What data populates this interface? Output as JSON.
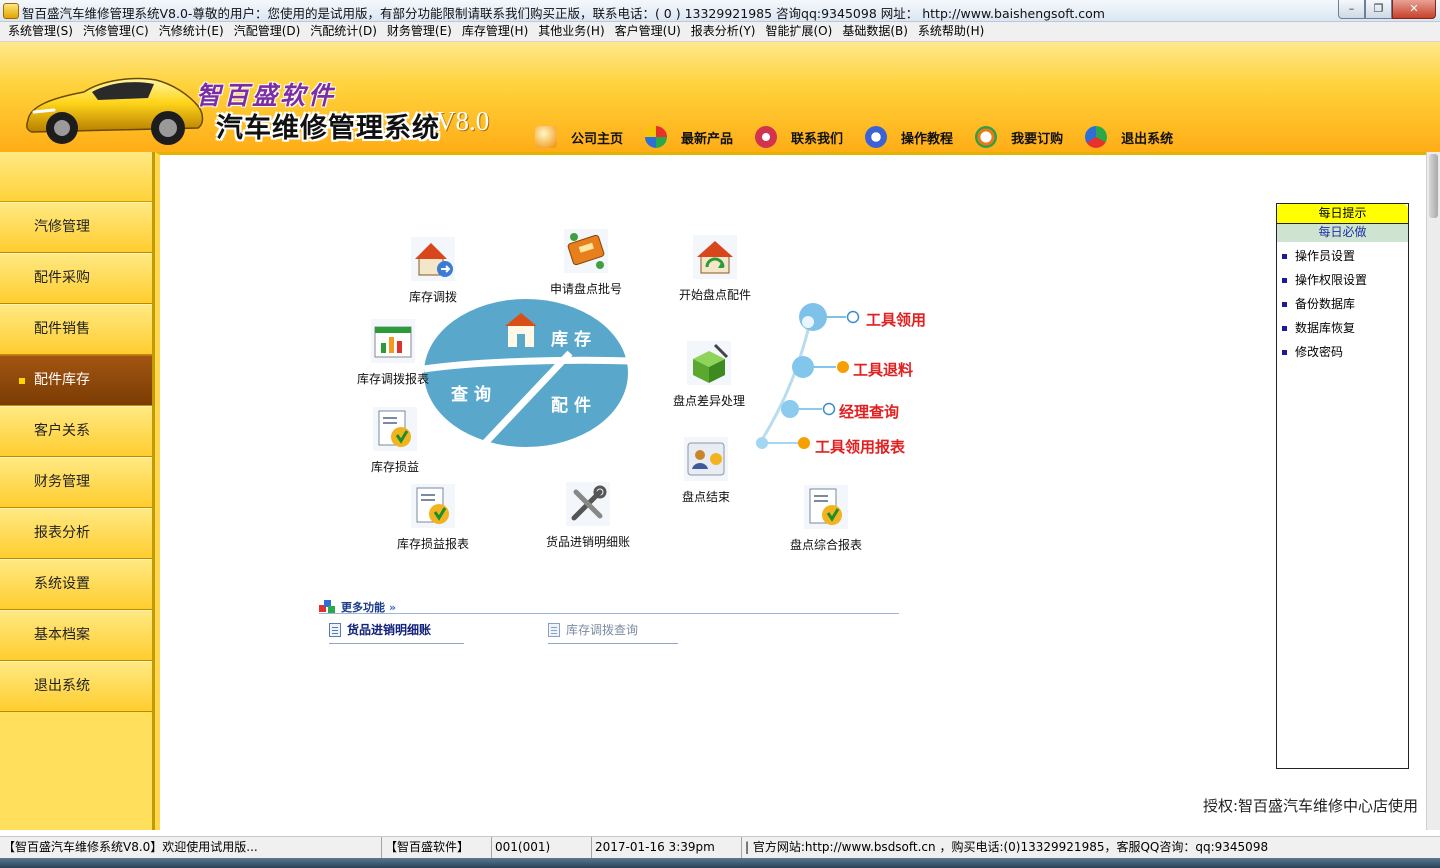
{
  "window": {
    "title": "智百盛汽车维修管理系统V8.0-尊敬的用户：您使用的是试用版，有部分功能限制请联系我们购买正版，联系电话：( 0 ) 13329921985  咨询qq:9345098   网址： http://www.baishengsoft.com",
    "controls": {
      "minimize": "–",
      "restore": "❐",
      "close": "✕"
    }
  },
  "menubar": [
    "系统管理(S)",
    "汽修管理(C)",
    "汽修统计(E)",
    "汽配管理(D)",
    "汽配统计(D)",
    "财务管理(E)",
    "库存管理(H)",
    "其他业务(H)",
    "客户管理(U)",
    "报表分析(Y)",
    "智能扩展(O)",
    "基础数据(B)",
    "系统帮助(H)"
  ],
  "brand": {
    "company": "智百盛软件",
    "product": "汽车维修管理系统",
    "version": "V8.0"
  },
  "topnav": [
    {
      "label": "公司主页",
      "icon": "home-star-icon"
    },
    {
      "label": "最新产品",
      "icon": "new-product-icon"
    },
    {
      "label": "联系我们",
      "icon": "contact-icon"
    },
    {
      "label": "操作教程",
      "icon": "tutorial-icon"
    },
    {
      "label": "我要订购",
      "icon": "order-icon"
    },
    {
      "label": "退出系统",
      "icon": "exit-icon"
    }
  ],
  "sidebar": {
    "items": [
      {
        "label": "汽修管理",
        "active": false
      },
      {
        "label": "配件采购",
        "active": false
      },
      {
        "label": "配件销售",
        "active": false
      },
      {
        "label": "配件库存",
        "active": true
      },
      {
        "label": "客户关系",
        "active": false
      },
      {
        "label": "财务管理",
        "active": false
      },
      {
        "label": "报表分析",
        "active": false
      },
      {
        "label": "系统设置",
        "active": false
      },
      {
        "label": "基本档案",
        "active": false
      },
      {
        "label": "退出系统",
        "active": false
      }
    ]
  },
  "hub": {
    "top": "库存",
    "left": "查询",
    "right": "配件"
  },
  "functions": [
    {
      "label": "库存调拨",
      "icon": "house-transfer-icon"
    },
    {
      "label": "申请盘点批号",
      "icon": "ticket-icon"
    },
    {
      "label": "开始盘点配件",
      "icon": "house-refresh-icon"
    },
    {
      "label": "库存调拨报表",
      "icon": "bar-report-icon"
    },
    {
      "label": "盘点差异处理",
      "icon": "box-edit-icon"
    },
    {
      "label": "库存损益",
      "icon": "document-money-icon"
    },
    {
      "label": "盘点结束",
      "icon": "person-money-icon"
    },
    {
      "label": "库存损益报表",
      "icon": "document-money-icon"
    },
    {
      "label": "货品进销明细账",
      "icon": "tools-icon"
    },
    {
      "label": "盘点综合报表",
      "icon": "document-money-icon"
    }
  ],
  "tools": [
    {
      "label": "工具领用",
      "marker": "hollow"
    },
    {
      "label": "工具退料",
      "marker": "filled"
    },
    {
      "label": "经理查询",
      "marker": "hollow"
    },
    {
      "label": "工具领用报表",
      "marker": "filled"
    }
  ],
  "more": {
    "title": "更多功能",
    "arrow": "»",
    "links": [
      {
        "label": "货品进销明细账",
        "bold": true
      },
      {
        "label": "库存调拨查询",
        "bold": false
      }
    ]
  },
  "tips": {
    "title": "每日提示",
    "subtitle": "每日必做",
    "items": [
      "操作员设置",
      "操作权限设置",
      "备份数据库",
      "数据库恢复",
      "修改密码"
    ]
  },
  "authorization": "授权:智百盛汽车维修中心店使用",
  "statusbar": [
    "【智百盛汽车维修系统V8.0】欢迎使用试用版...",
    "【智百盛软件】",
    "001(001)",
    "2017-01-16 3:39pm",
    "| 官方网站:http://www.bsdsoft.cn ，购买电话:(0)13329921985，客服QQ咨询：qq:9345098"
  ],
  "colors": {
    "header_top": "#ffe88c",
    "header_bottom": "#ffad16",
    "sidebar_bg": "#ffdf5c",
    "sidebar_active": "#8a4508",
    "hub_blue": "#5aa7cc",
    "tool_red": "#e32020",
    "tool_orange": "#f5a000"
  }
}
